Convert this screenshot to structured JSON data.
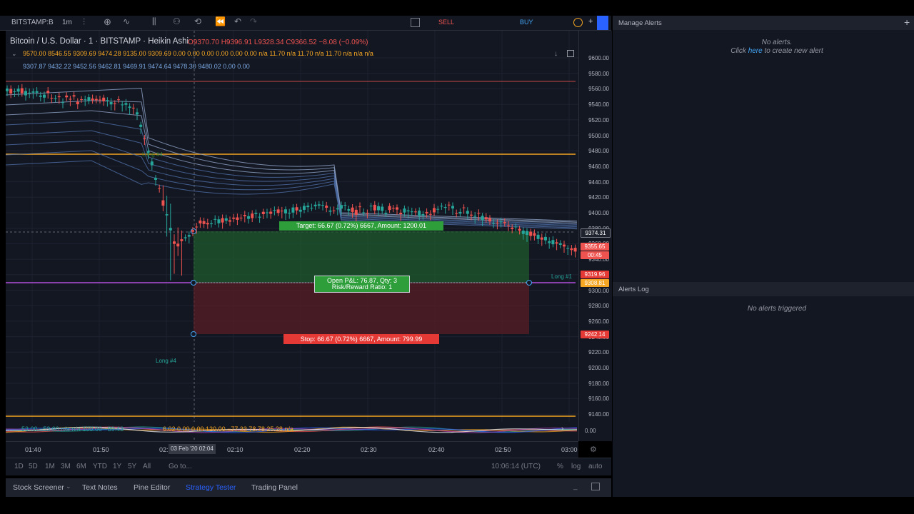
{
  "topbar": {
    "symbol": "BITSTAMP:B",
    "interval": "1m",
    "sell_label": "SELL",
    "buy_label": "BUY"
  },
  "legend": {
    "title": "Bitcoin / U.S. Dollar · 1 · BITSTAMP · Heikin Ashi",
    "ohlc": "O9370.70 H9396.91 L9328.34 C9366.52 −8.08 (−0.09%)",
    "line2": "9570.00 8546.55 9309.69 9474.28 9135.00 9309.69 0.00 0.00 0.00 0.00 0.00 0.00 n/a 11.70 n/a 11.70 n/a 11.70 n/a n/a n/a",
    "line3": "9307.87 9432.22 9452.56 9462.81 9469.91 9474.64 9478.30 9480.02 0.00 0.00"
  },
  "chart": {
    "target_label": "Target: 66.67 (0.72%) 6667, Amount: 1200.01",
    "pnl_line1": "Open P&L: 76.87, Qty: 3",
    "pnl_line2": "Risk/Reward Ratio: 1",
    "stop_label": "Stop: 66.67 (0.72%) 6667, Amount: 799.99",
    "long_label_1": "Long #4",
    "long_label_2": "Long #4",
    "long_label_3": "Long #1",
    "indicator_text": "53.00 −53.00 n/a n/a 100.00 −89.43",
    "indicator_values": "6.02 0.00 0.00 120.00 −77.33 78.78 25.28 n/a",
    "indicator_zero": "0.00",
    "colors": {
      "bg": "#131722",
      "up": "#26a69a",
      "down": "#ef5350",
      "target_zone": "#1e5a2c",
      "stop_zone": "#5a1e24",
      "orange_line": "#f5a623",
      "purple_line": "#b14fd9"
    }
  },
  "price_scale": {
    "ticks": [
      "9600.00",
      "9580.00",
      "9560.00",
      "9540.00",
      "9520.00",
      "9500.00",
      "9480.00",
      "9460.00",
      "9440.00",
      "9420.00",
      "9400.00",
      "9380.00",
      "9360.00",
      "9340.00",
      "9320.00",
      "9300.00",
      "9280.00",
      "9260.00",
      "9240.00",
      "9220.00",
      "9200.00",
      "9180.00",
      "9160.00",
      "9140.00"
    ],
    "label_current": "9374.31",
    "label_price": "9355.65",
    "label_countdown": "00:45",
    "label_red": "9319.96",
    "label_orange": "9308.81",
    "label_stop": "9242.14"
  },
  "time_axis": {
    "ticks": [
      "01:40",
      "01:50",
      "02:",
      "02:10",
      "02:20",
      "02:30",
      "02:40",
      "02:50",
      "03:00"
    ],
    "cursor_date": "03 Feb '20",
    "cursor_time": "02:04"
  },
  "range_bar": {
    "ranges": [
      "1D",
      "5D",
      "1M",
      "3M",
      "6M",
      "YTD",
      "1Y",
      "5Y",
      "All"
    ],
    "goto": "Go to...",
    "clock": "10:06:14 (UTC)",
    "percent": "%",
    "log": "log",
    "auto": "auto"
  },
  "bottom_tabs": [
    "Stock Screener",
    "Text Notes",
    "Pine Editor",
    "Strategy Tester",
    "Trading Panel"
  ],
  "active_tab": "Strategy Tester",
  "alerts": {
    "manage_title": "Manage Alerts",
    "no_alerts": "No alerts.",
    "click": "Click",
    "here": "here",
    "create_text": "to create new alert",
    "log_title": "Alerts Log",
    "no_triggered": "No alerts triggered"
  }
}
